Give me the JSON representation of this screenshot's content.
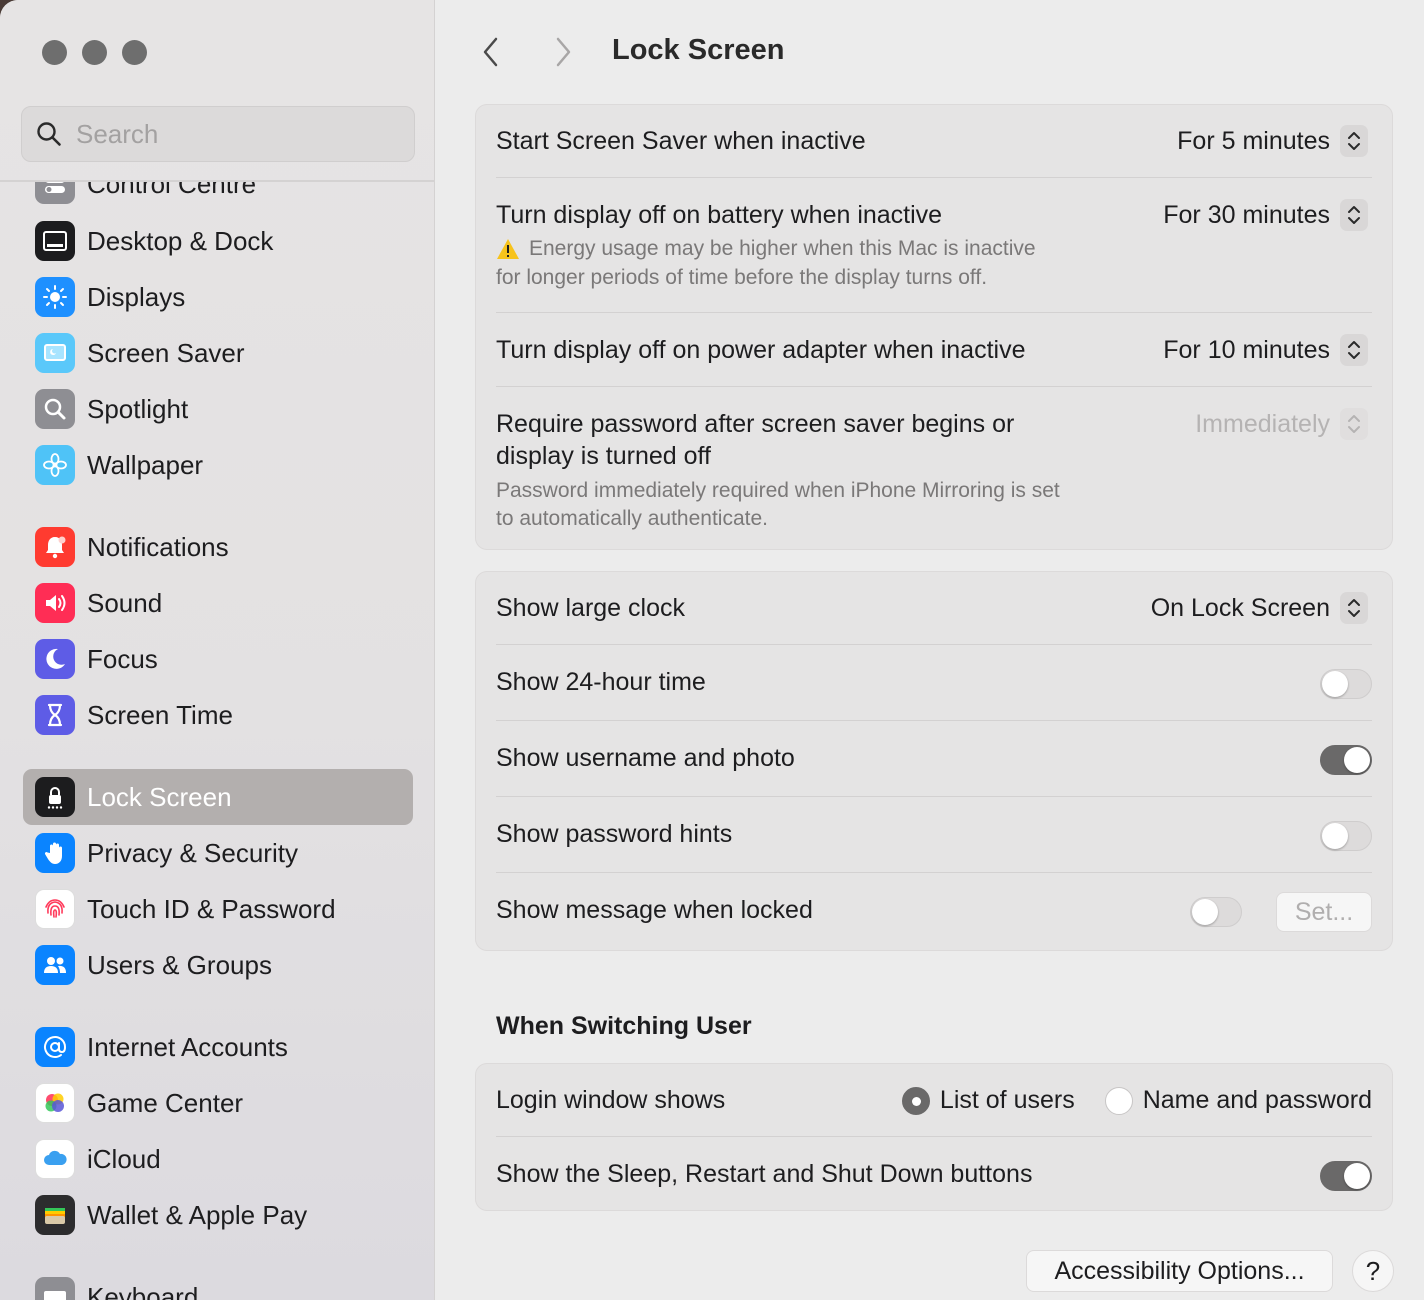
{
  "window": {
    "traffic_lights": [
      "close",
      "minimize",
      "zoom"
    ]
  },
  "search": {
    "placeholder": "Search"
  },
  "sidebar": {
    "items": [
      {
        "label": "Control Centre",
        "icon": "control-centre-icon",
        "color": "#8e8e93"
      },
      {
        "label": "Desktop & Dock",
        "icon": "desktop-dock-icon",
        "color": "#1c1c1e"
      },
      {
        "label": "Displays",
        "icon": "sun-icon",
        "color": "#1e90ff"
      },
      {
        "label": "Screen Saver",
        "icon": "screen-saver-icon",
        "color": "#5ac8fa"
      },
      {
        "label": "Spotlight",
        "icon": "magnifier-icon",
        "color": "#8e8e93"
      },
      {
        "label": "Wallpaper",
        "icon": "flower-icon",
        "color": "#4fc3f7"
      },
      {
        "label": "Notifications",
        "icon": "bell-icon",
        "color": "#ff3b30"
      },
      {
        "label": "Sound",
        "icon": "speaker-icon",
        "color": "#ff2d55"
      },
      {
        "label": "Focus",
        "icon": "moon-icon",
        "color": "#5e5ce6"
      },
      {
        "label": "Screen Time",
        "icon": "hourglass-icon",
        "color": "#5e5ce6"
      },
      {
        "label": "Lock Screen",
        "icon": "lock-icon",
        "color": "#1c1c1e",
        "active": true
      },
      {
        "label": "Privacy & Security",
        "icon": "hand-icon",
        "color": "#0a84ff"
      },
      {
        "label": "Touch ID & Password",
        "icon": "fingerprint-icon",
        "color": "#ffffff"
      },
      {
        "label": "Users & Groups",
        "icon": "users-icon",
        "color": "#0a84ff"
      },
      {
        "label": "Internet Accounts",
        "icon": "at-icon",
        "color": "#0a84ff"
      },
      {
        "label": "Game Center",
        "icon": "game-center-icon",
        "color": "#ffffff"
      },
      {
        "label": "iCloud",
        "icon": "cloud-icon",
        "color": "#ffffff"
      },
      {
        "label": "Wallet & Apple Pay",
        "icon": "wallet-icon",
        "color": "#2c2c2e"
      },
      {
        "label": "Keyboard",
        "icon": "keyboard-icon",
        "color": "#8e8e93"
      }
    ]
  },
  "header": {
    "title": "Lock Screen"
  },
  "group1": {
    "screen_saver": {
      "label": "Start Screen Saver when inactive",
      "value": "For 5 minutes"
    },
    "battery": {
      "label": "Turn display off on battery when inactive",
      "value": "For 30 minutes",
      "warning_line1": "Energy usage may be higher when this Mac is inactive",
      "warning_line2": "for longer periods of time before the display turns off."
    },
    "power_adapter": {
      "label": "Turn display off on power adapter when inactive",
      "value": "For 10 minutes"
    },
    "password": {
      "label_line1": "Require password after screen saver begins or",
      "label_line2": "display is turned off",
      "value": "Immediately",
      "sub_line1": "Password immediately required when iPhone Mirroring is set",
      "sub_line2": "to automatically authenticate."
    }
  },
  "group2": {
    "large_clock": {
      "label": "Show large clock",
      "value": "On Lock Screen"
    },
    "hour24": {
      "label": "Show 24-hour time",
      "on": false
    },
    "username": {
      "label": "Show username and photo",
      "on": true
    },
    "hints": {
      "label": "Show password hints",
      "on": false
    },
    "message": {
      "label": "Show message when locked",
      "on": false,
      "button": "Set..."
    }
  },
  "switching": {
    "title": "When Switching User",
    "login_window": {
      "label": "Login window shows",
      "options": [
        "List of users",
        "Name and password"
      ],
      "selected": "List of users"
    },
    "sleep_buttons": {
      "label": "Show the Sleep, Restart and Shut Down buttons",
      "on": true
    }
  },
  "footer": {
    "accessibility_button": "Accessibility Options...",
    "help_button": "?"
  }
}
